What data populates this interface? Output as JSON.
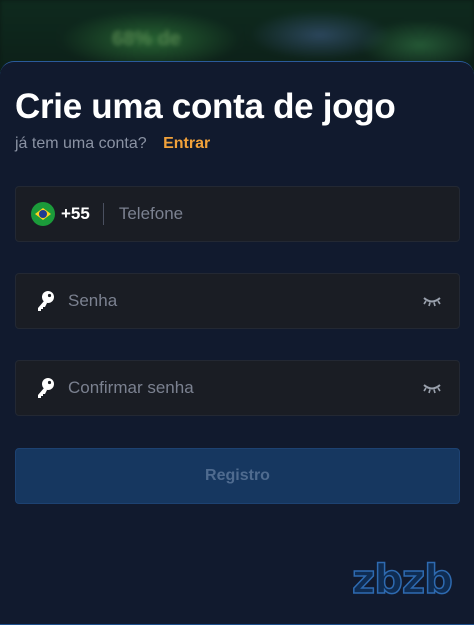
{
  "background": {
    "blurred_text": "68% de"
  },
  "form": {
    "title": "Crie uma conta de jogo",
    "have_account_text": "já tem uma conta?",
    "login_link": "Entrar",
    "phone": {
      "country_code": "+55",
      "flag_icon": "brazil-flag-icon",
      "placeholder": "Telefone"
    },
    "password": {
      "placeholder": "Senha",
      "icon": "key-icon",
      "toggle_icon": "eye-closed-icon"
    },
    "confirm_password": {
      "placeholder": "Confirmar senha",
      "icon": "key-icon",
      "toggle_icon": "eye-closed-icon"
    },
    "submit_label": "Registro"
  },
  "brand": {
    "watermark": "zbzb"
  },
  "colors": {
    "sheet_bg": "#111a2e",
    "field_bg": "#1a1d24",
    "accent_link": "#f2a23a",
    "button_bg": "#163760",
    "button_text": "#4f6b8f"
  }
}
